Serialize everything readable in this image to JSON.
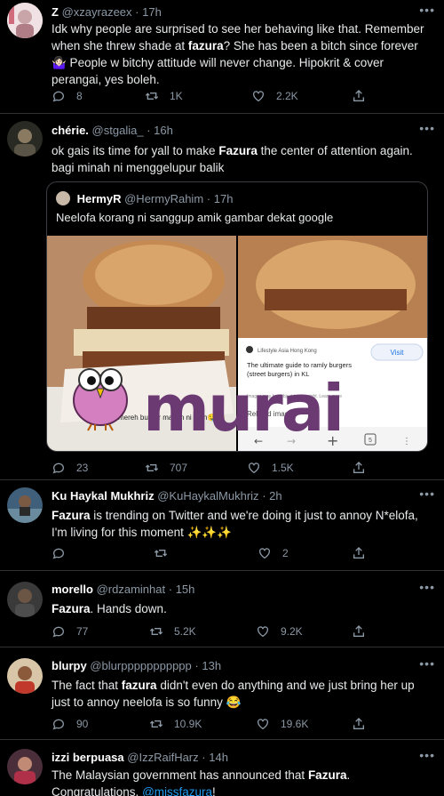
{
  "tweets": [
    {
      "name": "Z",
      "handle": "@xzayrazeex",
      "time": "17h",
      "text_parts": [
        "Idk why people are surprised to see her behaving like that. Remember when she threw shade at ",
        "fazura",
        "? She has been a bitch since forever 🤷🏻‍♀️ People w bitchy attitude will never change. Hipokrit & cover perangai, yes boleh."
      ],
      "replies": "8",
      "retweets": "1K",
      "likes": "2.2K"
    },
    {
      "name": "chérie.",
      "handle": "@stgalia_",
      "time": "16h",
      "text_parts": [
        "ok gais its time for yall to make ",
        "Fazura",
        " the center of attention again. bagi minah ni menggelupur balik"
      ],
      "quote": {
        "name": "HermyR",
        "handle": "@HermyRahim",
        "time": "17h",
        "text": "Neelofa korang ni sanggup amik gambar dekat google",
        "left_caption": "mereh burger malam ni meh🤤😋",
        "card_source": "Lifestyle Asia Hong Kong",
        "card_title": "The ultimate guide to ramly burgers (street burgers) in KL",
        "card_visit": "Visit",
        "card_related": "Related images",
        "card_meta": "Images may be subject to copyright. Learn more",
        "tab_count": "5"
      },
      "watermark": "murai",
      "replies": "23",
      "retweets": "707",
      "likes": "1.5K"
    },
    {
      "name": "Ku Haykal Mukhriz",
      "handle": "@KuHaykalMukhriz",
      "time": "2h",
      "text_parts": [
        "",
        "Fazura",
        " is trending on Twitter and we're doing it just to annoy N*elofa, I'm living for this moment ✨✨✨"
      ],
      "replies": "",
      "retweets": "",
      "likes": "2"
    },
    {
      "name": "morello",
      "handle": "@rdzaminhat",
      "time": "15h",
      "text_parts": [
        "",
        "Fazura",
        ". Hands down."
      ],
      "replies": "77",
      "retweets": "5.2K",
      "likes": "9.2K"
    },
    {
      "name": "blurpy",
      "handle": "@blurppppppppppp",
      "time": "13h",
      "text_parts": [
        "The fact that ",
        "fazura",
        " didn't even do anything and we just bring her up just to annoy neelofa is so funny 😂"
      ],
      "replies": "90",
      "retweets": "10.9K",
      "likes": "19.6K"
    },
    {
      "name": "izzi berpuasa",
      "handle": "@IzzRaifHarz",
      "time": "14h",
      "text_parts": [
        "The Malaysian government has announced that ",
        "Fazura",
        ". Congratulations, "
      ],
      "mention": "@missfazura",
      "mention_suffix": "!"
    }
  ],
  "icons": [
    "reply-icon",
    "retweet-icon",
    "like-icon",
    "share-icon",
    "more-icon"
  ],
  "colors": {
    "background": "#000000",
    "text": "#e7e9ea",
    "muted": "#8b98a5",
    "link": "#1d9bf0",
    "watermark": "#6b3a73"
  }
}
